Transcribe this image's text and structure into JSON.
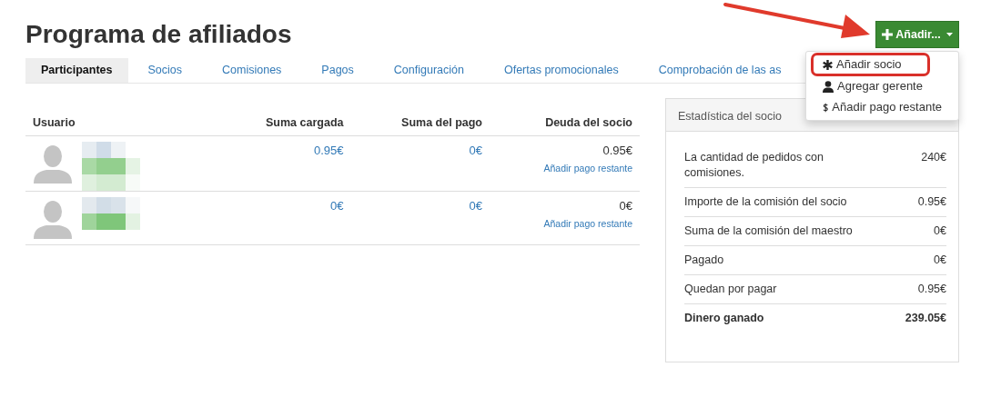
{
  "page_title": "Programa de afiliados",
  "tabs": [
    {
      "label": "Participantes",
      "selected": true
    },
    {
      "label": "Socios",
      "selected": false
    },
    {
      "label": "Comisiones",
      "selected": false
    },
    {
      "label": "Pagos",
      "selected": false
    },
    {
      "label": "Configuración",
      "selected": false
    },
    {
      "label": "Ofertas promocionales",
      "selected": false
    },
    {
      "label": "Comprobación de las as",
      "selected": false
    }
  ],
  "add_button": {
    "label": "Añadir..."
  },
  "add_menu": [
    {
      "kind": "asterisk",
      "label": "Añadir socio",
      "highlighted": true
    },
    {
      "kind": "person",
      "label": "Agregar gerente",
      "highlighted": false
    },
    {
      "kind": "dollar",
      "label": "Añadir pago restante",
      "highlighted": false
    }
  ],
  "table": {
    "columns": [
      "Usuario",
      "Suma cargada",
      "Suma del pago",
      "Deuda del socio"
    ],
    "rows": [
      {
        "suma_cargada": "0.95€",
        "suma_del_pago": "0€",
        "deuda": "0.95€",
        "action": "Añadir pago restante"
      },
      {
        "suma_cargada": "0€",
        "suma_del_pago": "0€",
        "deuda": "0€",
        "action": "Añadir pago restante"
      }
    ]
  },
  "stats": {
    "title": "Estadística del socio",
    "rows": [
      {
        "label": "La cantidad de pedidos con comisiones.",
        "value": "240€",
        "bold": false
      },
      {
        "label": "Importe de la comisión del socio",
        "value": "0.95€",
        "bold": false
      },
      {
        "label": "Suma de la comisión del maestro",
        "value": "0€",
        "bold": false
      },
      {
        "label": "Pagado",
        "value": "0€",
        "bold": false
      },
      {
        "label": "Quedan por pagar",
        "value": "0.95€",
        "bold": false
      },
      {
        "label": "Dinero ganado",
        "value": "239.05€",
        "bold": true
      }
    ]
  }
}
